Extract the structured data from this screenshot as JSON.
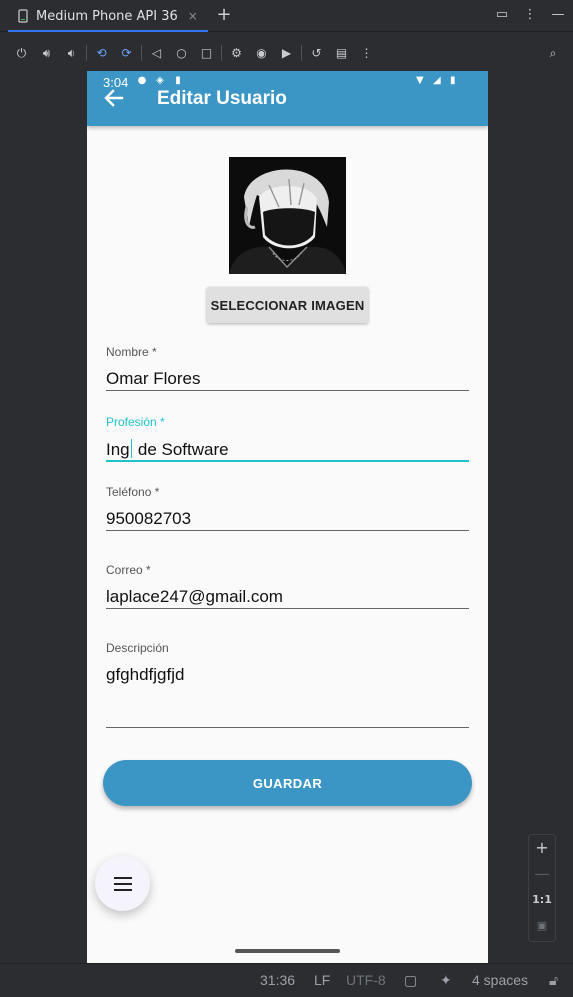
{
  "ide": {
    "tab_title": "Medium Phone API 36",
    "tab_close": "×",
    "tab_add": "+"
  },
  "app": {
    "status_time": "3:04",
    "title": "Editar Usuario",
    "select_image_label": "SELECCIONAR IMAGEN",
    "fields": {
      "nombre": {
        "label": "Nombre *",
        "value": "Omar Flores"
      },
      "profesion": {
        "label": "Profesión *",
        "value_before_caret": "Ing",
        "value_after_caret": " de Software"
      },
      "telefono": {
        "label": "Teléfono *",
        "value": "950082703"
      },
      "correo": {
        "label": "Correo *",
        "value": "laplace247@gmail.com"
      },
      "descripcion": {
        "label": "Descripción",
        "value": "gfghdfjgfjd"
      }
    },
    "save_label": "GUARDAR",
    "colors": {
      "appbar": "#3b96c5",
      "focus": "#1ec3c8"
    }
  },
  "zoom": {
    "plus": "+",
    "minus": "—",
    "reset": "1:1"
  },
  "statusbar": {
    "position": "31:36",
    "line_ending": "LF",
    "encoding": "UTF-8",
    "indent": "4 spaces"
  }
}
